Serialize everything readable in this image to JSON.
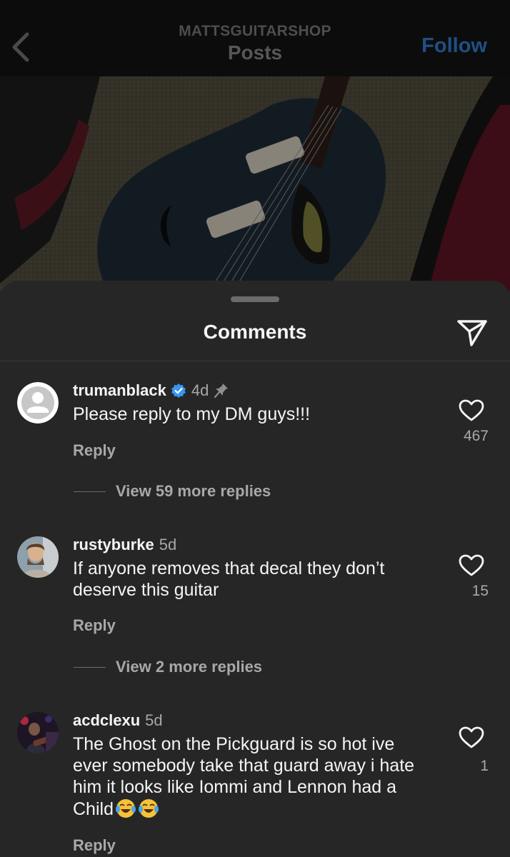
{
  "header": {
    "account": "MATTSGUITARSHOP",
    "title": "Posts",
    "follow_label": "Follow"
  },
  "sheet": {
    "title": "Comments"
  },
  "comments": [
    {
      "username": "trumanblack",
      "verified": true,
      "pinned": true,
      "time": "4d",
      "text": "Please reply to my DM guys!!!",
      "reply_label": "Reply",
      "likes": "467",
      "view_more": "View 59 more replies"
    },
    {
      "username": "rustyburke",
      "time": "5d",
      "text": "If anyone removes that decal they don’t deserve this guitar",
      "reply_label": "Reply",
      "likes": "15",
      "view_more": "View 2 more replies"
    },
    {
      "username": "acdclexu",
      "time": "5d",
      "text": "The Ghost on the Pickguard is so hot  ive ever somebody take that guard away i hate him it looks like Iommi and Lennon had a Child",
      "emoji": "😂😂",
      "reply_label": "Reply",
      "likes": "1"
    }
  ],
  "icons": {
    "back": "chevron-left-icon",
    "share": "paper-plane-icon",
    "like": "heart-outline-icon",
    "verified": "verified-badge-icon",
    "pin": "pin-icon"
  },
  "colors": {
    "background": "#262626",
    "verified": "#3897f0",
    "follow": "#1f4f86",
    "muted_text": "#a8a8a8"
  }
}
